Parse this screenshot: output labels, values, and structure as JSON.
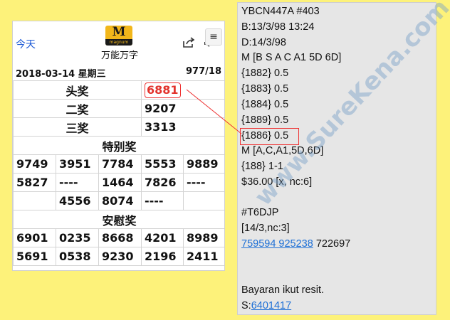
{
  "lottery": {
    "today_label": "今天",
    "logo_letter": "M",
    "logo_word": "magnum",
    "app_title": "万能万字",
    "date": "2018-03-14 星期三",
    "draw_no": "977/18",
    "prizes": {
      "first_label": "头奖",
      "first": "6881",
      "second_label": "二奖",
      "second": "9207",
      "third_label": "三奖",
      "third": "3313"
    },
    "special_label": "特别奖",
    "special": [
      [
        "9749",
        "3951",
        "7784",
        "5553",
        "9889"
      ],
      [
        "5827",
        "----",
        "1464",
        "7826",
        "----"
      ],
      [
        "",
        "4556",
        "8074",
        "----",
        ""
      ]
    ],
    "consolation_label": "安慰奖",
    "consolation": [
      [
        "6901",
        "0235",
        "8668",
        "4201",
        "8989"
      ],
      [
        "5691",
        "0538",
        "9230",
        "2196",
        "2411"
      ]
    ]
  },
  "ticket": {
    "lines": [
      "YBCN447A #403",
      "B:13/3/98 13:24",
      "D:14/3/98",
      "M [B S A C A1 5D 6D]",
      "{1882} 0.5",
      "{1883} 0.5",
      "{1884} 0.5",
      "{1889} 0.5"
    ],
    "highlight_line": "{1886} 0.5",
    "lines2": [
      "M [A,C,A1,5D,6D]",
      "{188} 1-1",
      "$36.00 [x, nc:6]",
      "",
      "#T6DJP",
      "[14/3,nc:3]"
    ],
    "link1": "759594 925238",
    "after_link1": " 722697",
    "lines3": [
      "",
      "",
      "Bayaran ikut resit."
    ],
    "s_prefix": "S:",
    "s_link": "6401417"
  },
  "watermark": "www.SureKena.com",
  "colors": {
    "background": "#fdf27a",
    "highlight": "#e2332c",
    "link": "#1d6fd6",
    "logo": "#f2b71b"
  }
}
